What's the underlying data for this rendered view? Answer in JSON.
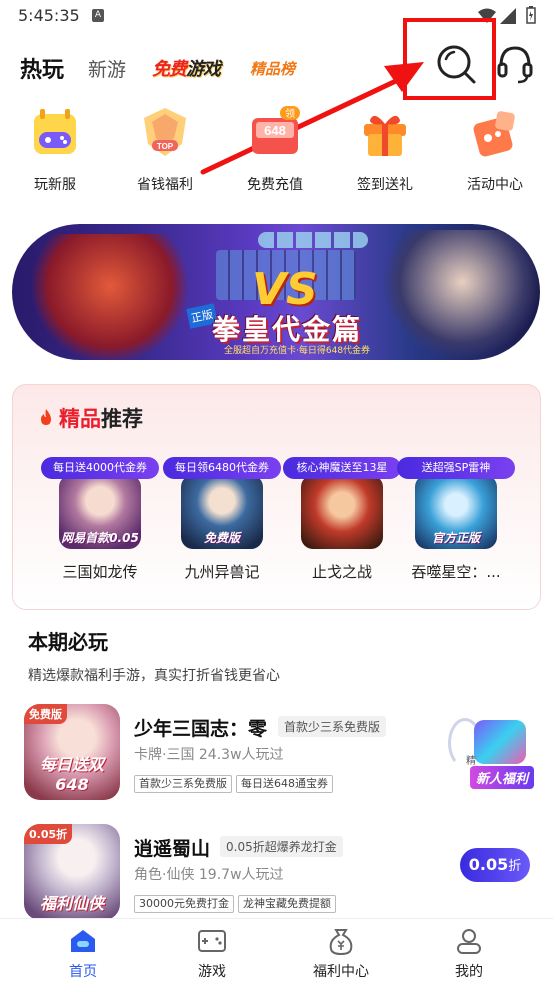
{
  "status_bar": {
    "time": "5:45:35",
    "notification_badge": "A"
  },
  "top_nav": {
    "tabs": [
      {
        "label": "热玩",
        "active": true
      },
      {
        "label": "新游",
        "active": false
      },
      {
        "label_part1": "免费",
        "label_part2": "游戏",
        "active": false
      },
      {
        "label": "精品榜",
        "active": false
      }
    ],
    "icons": [
      "search-icon",
      "headset-icon"
    ]
  },
  "quick_entries": [
    {
      "label": "玩新服",
      "icon": "gamepad-calendar-icon"
    },
    {
      "label": "省钱福利",
      "icon": "top-medal-icon"
    },
    {
      "label": "免费充值",
      "icon": "recharge-648-icon",
      "badge": "领"
    },
    {
      "label": "签到送礼",
      "icon": "gift-box-icon"
    },
    {
      "label": "活动中心",
      "icon": "activity-icon"
    }
  ],
  "banner": {
    "vs": "VS",
    "title": "拳皇代金篇",
    "tag": "正版",
    "subtitle": "全服超自万充值卡·每日得648代金券"
  },
  "featured": {
    "title_highlight": "精品",
    "title_rest": "推荐",
    "games": [
      {
        "badge": "每日送4000代金券",
        "name": "三国如龙传",
        "caption": "网易首款0.05"
      },
      {
        "badge": "每日领6480代金券",
        "name": "九州异兽记",
        "caption": "免费版"
      },
      {
        "badge": "核心神魔送至13星",
        "name": "止戈之战",
        "caption": ""
      },
      {
        "badge": "送超强SP雷神",
        "name": "吞噬星空：...",
        "caption": "官方正版"
      }
    ]
  },
  "must_play": {
    "title": "本期必玩",
    "description": "精选爆款福利手游，真实打折省钱更省心",
    "items": [
      {
        "title": "少年三国志：零",
        "hint": "首款少三系免费版",
        "meta": "卡牌·三国  24.3w人玩过",
        "tags": [
          "首款少三系免费版",
          "每日送648通宝券"
        ],
        "thumb_caption": "每日送双648",
        "thumb_corner": "免费版"
      },
      {
        "title": "逍遥蜀山",
        "hint": "0.05折超爆养龙打金",
        "meta": "角色·仙侠  19.7w人玩过",
        "tags": [
          "30000元免费打金",
          "龙神宝藏免费提额"
        ],
        "thumb_caption": "福利仙侠",
        "thumb_corner": "0.05折",
        "discount": "0.05",
        "discount_unit": "折"
      }
    ]
  },
  "promo": {
    "small_text": "精",
    "label": "新人福利"
  },
  "tab_bar": [
    {
      "label": "首页",
      "icon": "home-icon",
      "active": true
    },
    {
      "label": "游戏",
      "icon": "gamepad-icon",
      "active": false
    },
    {
      "label": "福利中心",
      "icon": "money-bag-icon",
      "active": false
    },
    {
      "label": "我的",
      "icon": "user-icon",
      "active": false
    }
  ],
  "colors": {
    "accent": "#2a5af0",
    "highlight_red": "#ea1e2d",
    "annotation_red": "#f01111"
  }
}
